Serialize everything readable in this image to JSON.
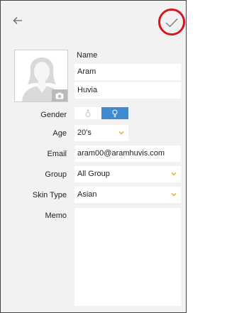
{
  "profile": {
    "name_label": "Name",
    "first_name": "Aram",
    "last_name": "Huvia"
  },
  "labels": {
    "gender": "Gender",
    "age": "Age",
    "email": "Email",
    "group": "Group",
    "skin_type": "Skin Type",
    "memo": "Memo"
  },
  "values": {
    "gender_selected": "female",
    "age": "20's",
    "email": "aram00@aramhuvis.com",
    "group": "All Group",
    "skin_type": "Asian",
    "memo": ""
  },
  "icons": {
    "back": "back-arrow-icon",
    "confirm": "check-icon",
    "male": "male-icon",
    "female": "female-icon",
    "camera": "camera-icon",
    "dropdown": "chevron-down-icon"
  },
  "colors": {
    "accent_blue": "#3f8ad0",
    "dropdown_orange": "#f0a21a",
    "highlight_red": "#d6161b",
    "background": "#f2f2f2"
  }
}
